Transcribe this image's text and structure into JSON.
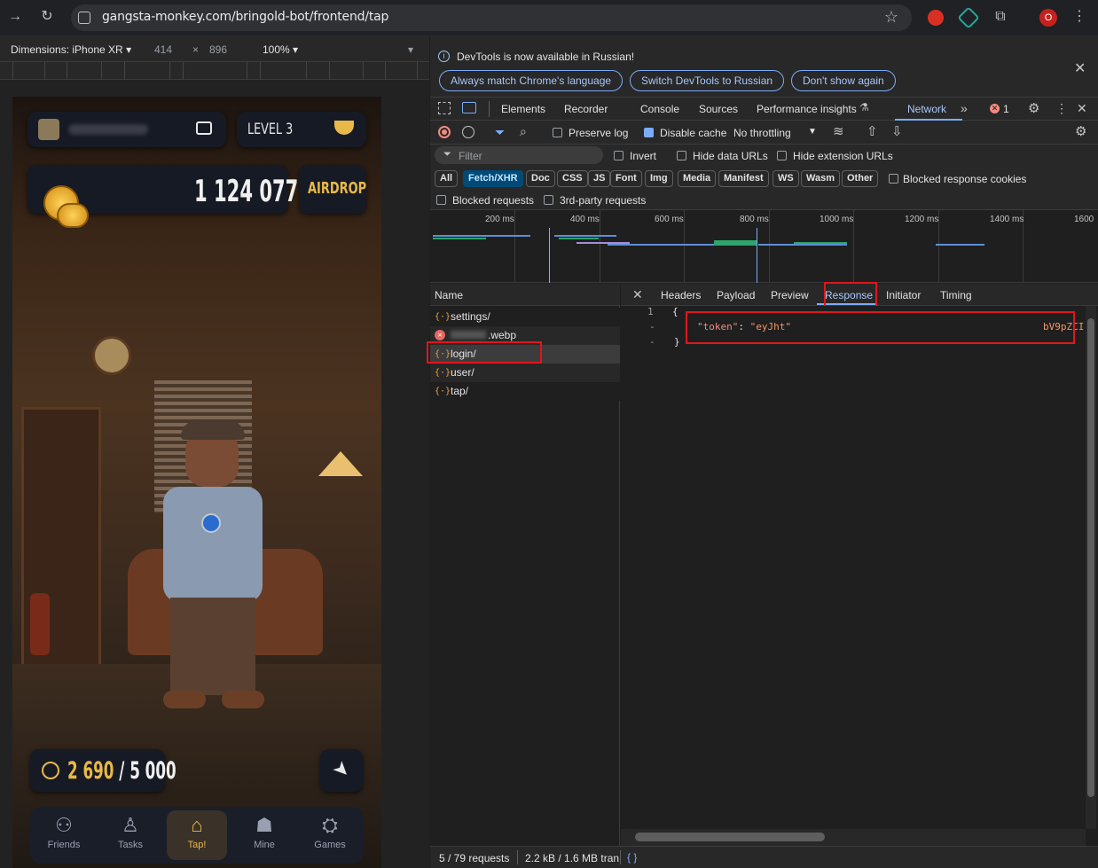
{
  "browser": {
    "url": "gangsta-monkey.com/bringold-bot/frontend/tap",
    "profile_initial": "O"
  },
  "device_toolbar": {
    "device": "Dimensions: iPhone XR",
    "width": "414",
    "times": "×",
    "height": "896",
    "zoom": "100%"
  },
  "game": {
    "level": "LEVEL 3",
    "balance": "1 124 077",
    "airdrop": "AIRDROP",
    "energy_current": "2 690",
    "energy_sep": "/",
    "energy_max": "5 000",
    "nav": [
      {
        "label": "Friends",
        "icon": "friends-icon"
      },
      {
        "label": "Tasks",
        "icon": "tasks-icon"
      },
      {
        "label": "Tap!",
        "icon": "tap-icon"
      },
      {
        "label": "Mine",
        "icon": "mine-icon"
      },
      {
        "label": "Games",
        "icon": "games-icon"
      }
    ],
    "accent": "#e9b84a"
  },
  "devtools": {
    "banner_text": "DevTools is now available in Russian!",
    "banner_buttons": [
      "Always match Chrome's language",
      "Switch DevTools to Russian",
      "Don't show again"
    ],
    "tabs": [
      "Elements",
      "Recorder",
      "Console",
      "Sources",
      "Performance insights",
      "Network"
    ],
    "active_tab": "Network",
    "error_count": "1",
    "toolbar": {
      "preserve_log": "Preserve log",
      "disable_cache": "Disable cache",
      "throttling": "No throttling"
    },
    "filter": {
      "placeholder": "Filter",
      "invert": "Invert",
      "hide_data": "Hide data URLs",
      "hide_ext": "Hide extension URLs"
    },
    "types": [
      "All",
      "Fetch/XHR",
      "Doc",
      "CSS",
      "JS",
      "Font",
      "Img",
      "Media",
      "Manifest",
      "WS",
      "Wasm",
      "Other"
    ],
    "active_type": "Fetch/XHR",
    "blocked_cookies": "Blocked response cookies",
    "blocked_requests": "Blocked requests",
    "third_party": "3rd-party requests",
    "timeline_ticks": [
      "200 ms",
      "400 ms",
      "600 ms",
      "800 ms",
      "1000 ms",
      "1200 ms",
      "1400 ms",
      "1600"
    ],
    "name_header": "Name",
    "requests": [
      {
        "name": "settings/",
        "icon": "{·}",
        "error": false
      },
      {
        "name": ".webp",
        "icon": "✕",
        "error": true
      },
      {
        "name": "login/",
        "icon": "{·}",
        "error": false
      },
      {
        "name": "user/",
        "icon": "{·}",
        "error": false
      },
      {
        "name": "tap/",
        "icon": "{·}",
        "error": false
      }
    ],
    "detail_tabs": [
      "Headers",
      "Payload",
      "Preview",
      "Response",
      "Initiator",
      "Timing"
    ],
    "active_detail_tab": "Response",
    "response": {
      "line1_num": "1",
      "line1": "{",
      "line2_num": "-",
      "key": "\"token\"",
      "colon": ": ",
      "value_start": "\"eyJht\"",
      "value_end": "bV9pZCI",
      "line3_num": "-",
      "line3": "}"
    },
    "status": {
      "requests": "5 / 79 requests",
      "transferred": "2.2 kB / 1.6 MB tran",
      "braces": "{ }"
    }
  }
}
